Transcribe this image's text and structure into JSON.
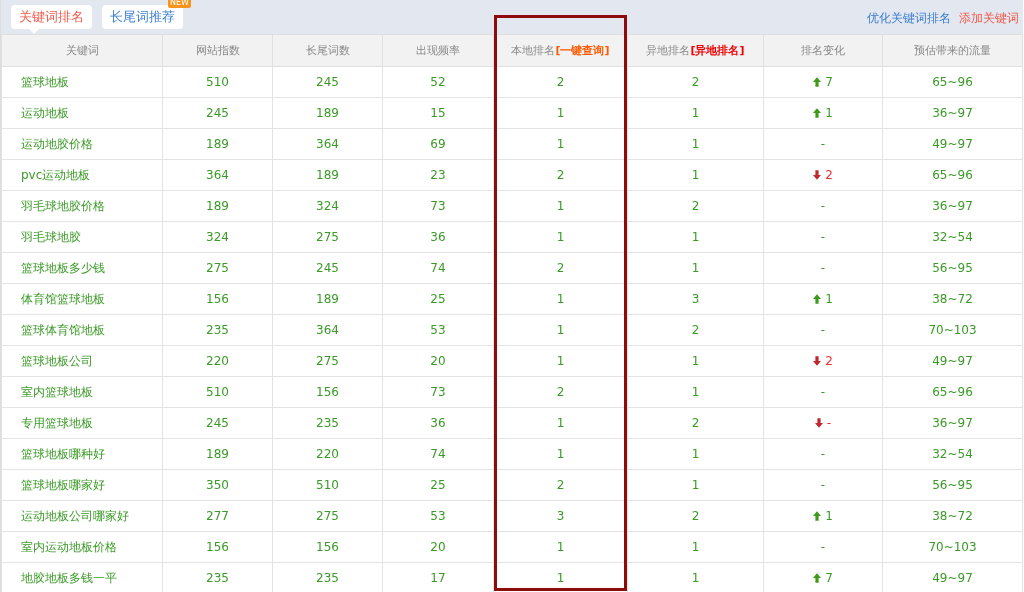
{
  "tabs": [
    {
      "label": "关键词排名",
      "selected": true
    },
    {
      "label": "长尾词推荐",
      "selected": false,
      "badge": "NEW"
    }
  ],
  "actions": [
    {
      "label": "优化关键词排名",
      "kind": "primary"
    },
    {
      "label": "添加关键词",
      "kind": "accent"
    }
  ],
  "table": {
    "columns": [
      {
        "label": "关键词",
        "kind": "plain"
      },
      {
        "label": "网站指数",
        "kind": "plain"
      },
      {
        "label": "长尾词数",
        "kind": "plain"
      },
      {
        "label": "出现频率",
        "kind": "plain"
      },
      {
        "label": "本地排名",
        "link": "[一键查询]",
        "kind": "query"
      },
      {
        "label": "异地排名",
        "link": "[异地排名]",
        "kind": "alert"
      },
      {
        "label": "排名变化",
        "kind": "plain"
      },
      {
        "label": "预估带来的流量",
        "kind": "plain"
      }
    ],
    "rows": [
      {
        "keyword": "篮球地板",
        "index": "510",
        "longtail": "245",
        "frequency": "52",
        "local": "2",
        "remote": "2",
        "change": {
          "kind": "up",
          "value": "7"
        },
        "traffic": "65~96"
      },
      {
        "keyword": "运动地板",
        "index": "245",
        "longtail": "189",
        "frequency": "15",
        "local": "1",
        "remote": "1",
        "change": {
          "kind": "up",
          "value": "1"
        },
        "traffic": "36~97"
      },
      {
        "keyword": "运动地胶价格",
        "index": "189",
        "longtail": "364",
        "frequency": "69",
        "local": "1",
        "remote": "1",
        "change": {
          "kind": "none",
          "value": "-"
        },
        "traffic": "49~97"
      },
      {
        "keyword": "pvc运动地板",
        "index": "364",
        "longtail": "189",
        "frequency": "23",
        "local": "2",
        "remote": "1",
        "change": {
          "kind": "down",
          "value": "2"
        },
        "traffic": "65~96"
      },
      {
        "keyword": "羽毛球地胶价格",
        "index": "189",
        "longtail": "324",
        "frequency": "73",
        "local": "1",
        "remote": "2",
        "change": {
          "kind": "none",
          "value": "-"
        },
        "traffic": "36~97"
      },
      {
        "keyword": "羽毛球地胶",
        "index": "324",
        "longtail": "275",
        "frequency": "36",
        "local": "1",
        "remote": "1",
        "change": {
          "kind": "none",
          "value": "-"
        },
        "traffic": "32~54"
      },
      {
        "keyword": "篮球地板多少钱",
        "index": "275",
        "longtail": "245",
        "frequency": "74",
        "local": "2",
        "remote": "1",
        "change": {
          "kind": "none",
          "value": "-"
        },
        "traffic": "56~95"
      },
      {
        "keyword": "体育馆篮球地板",
        "index": "156",
        "longtail": "189",
        "frequency": "25",
        "local": "1",
        "remote": "3",
        "change": {
          "kind": "up",
          "value": "1"
        },
        "traffic": "38~72"
      },
      {
        "keyword": "篮球体育馆地板",
        "index": "235",
        "longtail": "364",
        "frequency": "53",
        "local": "1",
        "remote": "2",
        "change": {
          "kind": "none",
          "value": "-"
        },
        "traffic": "70~103"
      },
      {
        "keyword": "篮球地板公司",
        "index": "220",
        "longtail": "275",
        "frequency": "20",
        "local": "1",
        "remote": "1",
        "change": {
          "kind": "down",
          "value": "2"
        },
        "traffic": "49~97"
      },
      {
        "keyword": "室内篮球地板",
        "index": "510",
        "longtail": "156",
        "frequency": "73",
        "local": "2",
        "remote": "1",
        "change": {
          "kind": "none",
          "value": "-"
        },
        "traffic": "65~96"
      },
      {
        "keyword": "专用篮球地板",
        "index": "245",
        "longtail": "235",
        "frequency": "36",
        "local": "1",
        "remote": "2",
        "change": {
          "kind": "down",
          "value": "-"
        },
        "traffic": "36~97"
      },
      {
        "keyword": "篮球地板哪种好",
        "index": "189",
        "longtail": "220",
        "frequency": "74",
        "local": "1",
        "remote": "1",
        "change": {
          "kind": "none",
          "value": "-"
        },
        "traffic": "32~54"
      },
      {
        "keyword": "篮球地板哪家好",
        "index": "350",
        "longtail": "510",
        "frequency": "25",
        "local": "2",
        "remote": "1",
        "change": {
          "kind": "none",
          "value": "-"
        },
        "traffic": "56~95"
      },
      {
        "keyword": "运动地板公司哪家好",
        "index": "277",
        "longtail": "275",
        "frequency": "53",
        "local": "3",
        "remote": "2",
        "change": {
          "kind": "up",
          "value": "1"
        },
        "traffic": "38~72"
      },
      {
        "keyword": "室内运动地板价格",
        "index": "156",
        "longtail": "156",
        "frequency": "20",
        "local": "1",
        "remote": "1",
        "change": {
          "kind": "none",
          "value": "-"
        },
        "traffic": "70~103"
      },
      {
        "keyword": "地胶地板多钱一平",
        "index": "235",
        "longtail": "235",
        "frequency": "17",
        "local": "1",
        "remote": "1",
        "change": {
          "kind": "up",
          "value": "7"
        },
        "traffic": "49~97"
      }
    ]
  }
}
